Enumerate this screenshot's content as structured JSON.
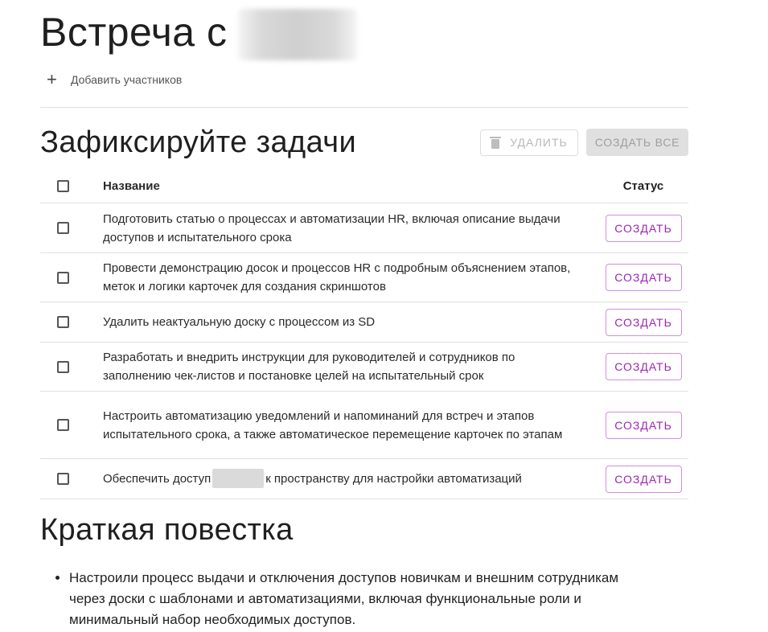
{
  "header": {
    "title": "Встреча с",
    "add_participants_icon": "plus-icon",
    "add_participants_label": "Добавить участников"
  },
  "tasks": {
    "section_title": "Зафиксируйте задачи",
    "delete_label": "УДАЛИТЬ",
    "delete_icon": "trash-icon",
    "create_all_label": "СОЗДАТЬ ВСЕ",
    "columns": {
      "name": "Название",
      "status": "Статус"
    },
    "rows": [
      {
        "name": "Подготовить статью о процессах и автоматизации HR, включая описание выдачи доступов и испытательного срока",
        "action": "СОЗДАТЬ"
      },
      {
        "name": "Провести демонстрацию досок и процессов HR с подробным объяснением этапов, меток и логики карточек для создания скриншотов",
        "action": "СОЗДАТЬ"
      },
      {
        "name": "Удалить неактуальную доску с процессом из SD",
        "action": "СОЗДАТЬ"
      },
      {
        "name": "Разработать и внедрить инструкции для руководителей и сотрудников по заполнению чек-листов и постановке целей на испытательный срок",
        "action": "СОЗДАТЬ"
      },
      {
        "name": "Настроить автоматизацию уведомлений и напоминаний для встреч и этапов испытательного срока, а также автоматическое перемещение карточек по этапам",
        "action": "СОЗДАТЬ"
      },
      {
        "name_before": "Обеспечить доступ",
        "name_after": "к пространству для настройки автоматизаций",
        "action": "СОЗДАТЬ"
      }
    ]
  },
  "agenda": {
    "title": "Краткая повестка",
    "items": [
      "Настроили процесс выдачи и отключения доступов новичкам и внешним сотрудникам через доски с шаблонами и автоматизациями, включая функциональные роли и минимальный набор необходимых доступов."
    ]
  },
  "colors": {
    "accent": "#9c27b0",
    "accent_border": "#d38ee0",
    "divider": "#e0e0e0",
    "disabled_bg": "#e0e0e0",
    "disabled_text": "#9e9e9e"
  }
}
